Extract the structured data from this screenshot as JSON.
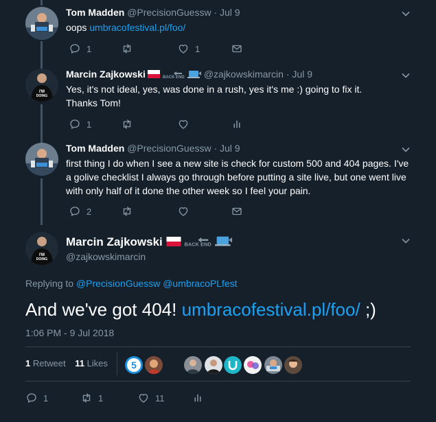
{
  "replies": [
    {
      "name": "Tom Madden",
      "handle": "@PrecisionGuessw",
      "dot": " · ",
      "date": "Jul 9",
      "text_prefix": "oops ",
      "link": "umbracofestival.pl/foo/",
      "counts": {
        "reply": "1",
        "retweet": "",
        "like": "1"
      }
    },
    {
      "name": "Marcin Zajkowski",
      "handle": "@zajkowskimarcin",
      "dot": " · ",
      "date": "Jul 9",
      "text": "Yes, it's not ideal, yes, was done in a rush, yes it's me :) going to fix it. Thanks Tom!",
      "counts": {
        "reply": "1",
        "retweet": "",
        "like": ""
      }
    },
    {
      "name": "Tom Madden",
      "handle": "@PrecisionGuessw",
      "dot": " · ",
      "date": "Jul 9",
      "text": "first thing I do when I see a new site is check for custom 500 and 404 pages. I've a golive checklist I always go through before putting a site live, but one went live with only half of it done the other week so I feel your pain.",
      "counts": {
        "reply": "2",
        "retweet": "",
        "like": ""
      }
    }
  ],
  "main": {
    "name": "Marcin Zajkowski",
    "handle": "@zajkowskimarcin",
    "replying_label": "Replying to ",
    "replying_to": [
      "@PrecisionGuessw",
      "@umbracoPLfest"
    ],
    "text_prefix": "And we've got 404! ",
    "link": "umbracofestival.pl/foo/",
    "text_suffix": " ;)",
    "timestamp": "1:06 PM - 9 Jul 2018",
    "stats": {
      "retweets_count": "1",
      "retweets_label": "Retweet",
      "likes_count": "11",
      "likes_label": "Likes"
    },
    "counts": {
      "reply": "1",
      "retweet": "1",
      "like": "11"
    }
  },
  "name_decoration": {
    "backend_text": "BACK END"
  },
  "icons": {
    "reply": "reply-icon",
    "retweet": "retweet-icon",
    "like": "heart-icon",
    "dm": "envelope-icon",
    "analytics": "analytics-icon",
    "caret": "chevron-down-icon"
  },
  "colors": {
    "background": "#15202b",
    "muted": "#8899a6",
    "link": "#1da1f2",
    "thread_line": "#3d5466"
  }
}
